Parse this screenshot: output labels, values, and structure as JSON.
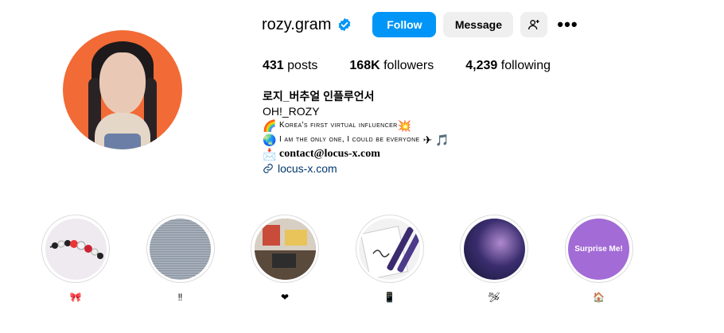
{
  "profile": {
    "username": "rozy.gram",
    "verified_icon": "verified-badge-icon",
    "follow_label": "Follow",
    "message_label": "Message",
    "add_user_icon": "add-user-icon",
    "more_icon": "more-options-icon",
    "more_glyph": "•••",
    "accent_color": "#0095f6"
  },
  "stats": {
    "posts_count": "431",
    "posts_label": "posts",
    "followers_count": "168K",
    "followers_label": "followers",
    "following_count": "4,239",
    "following_label": "following"
  },
  "bio": {
    "name": "로지_버추얼 인플루언서",
    "handle_line": "OH!_ROZY",
    "line1_emoji": "🌈",
    "line1_text": "Korea's first virtual influencer",
    "line1_emoji_end": "💥",
    "line2_emoji": "🌏",
    "line2_text": "I am the only one, I could be everyone",
    "line2_emoji_end": "✈ 🎵",
    "contact_emoji": "📩",
    "contact_text": "contact@locus-x.com",
    "link_icon": "link-icon",
    "link_text": "locus-x.com"
  },
  "highlights": [
    {
      "label": "🎀",
      "cover_text": ""
    },
    {
      "label": "‼",
      "cover_text": ""
    },
    {
      "label": "❤",
      "cover_text": ""
    },
    {
      "label": "📱",
      "cover_text": ""
    },
    {
      "label": "🛩",
      "cover_text": ""
    },
    {
      "label": "🏠",
      "cover_text": "Surprise Me!"
    }
  ]
}
